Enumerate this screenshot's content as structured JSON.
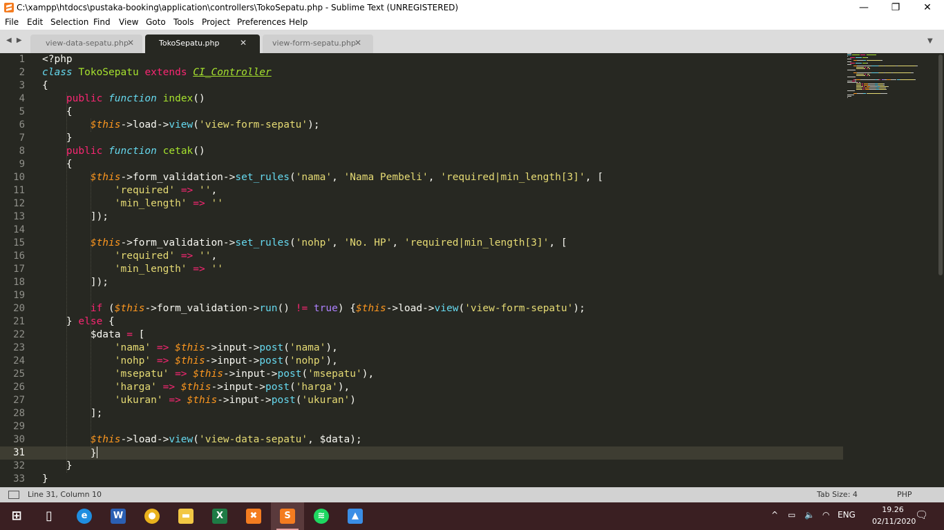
{
  "window": {
    "title": "C:\\xampp\\htdocs\\pustaka-booking\\application\\controllers\\TokoSepatu.php - Sublime Text (UNREGISTERED)",
    "minimize": "—",
    "maximize": "❐",
    "close": "✕"
  },
  "menu": [
    "File",
    "Edit",
    "Selection",
    "Find",
    "View",
    "Goto",
    "Tools",
    "Project",
    "Preferences",
    "Help"
  ],
  "tabs": [
    {
      "label": "view-data-sepatu.php",
      "close": "✕",
      "active": false
    },
    {
      "label": "TokoSepatu.php",
      "close": "✕",
      "active": true
    },
    {
      "label": "view-form-sepatu.php",
      "close": "✕",
      "active": false
    }
  ],
  "tabbar": {
    "nav": "◀ ▶",
    "dropdown": "▼"
  },
  "editor": {
    "line_numbers": [
      "1",
      "2",
      "3",
      "4",
      "5",
      "6",
      "7",
      "8",
      "9",
      "10",
      "11",
      "12",
      "13",
      "14",
      "15",
      "16",
      "17",
      "18",
      "19",
      "20",
      "21",
      "22",
      "23",
      "24",
      "25",
      "26",
      "27",
      "28",
      "29",
      "30",
      "31",
      "32",
      "33"
    ],
    "active_line": 31,
    "lines": [
      [
        [
          "<?php",
          "pl"
        ]
      ],
      [
        [
          "class",
          "st"
        ],
        [
          " ",
          "pl"
        ],
        [
          "TokoSepatu",
          "ent"
        ],
        [
          " ",
          "pl"
        ],
        [
          "extends",
          "kw"
        ],
        [
          " ",
          "pl"
        ],
        [
          "CI_Controller",
          "inh"
        ]
      ],
      [
        [
          "{",
          "pl"
        ]
      ],
      [
        [
          "    ",
          "pl"
        ],
        [
          "public",
          "kw"
        ],
        [
          " ",
          "pl"
        ],
        [
          "function",
          "st"
        ],
        [
          " ",
          "pl"
        ],
        [
          "index",
          "ent"
        ],
        [
          "()",
          "pl"
        ]
      ],
      [
        [
          "    {",
          "pl"
        ]
      ],
      [
        [
          "        ",
          "pl"
        ],
        [
          "$this",
          "var"
        ],
        [
          "->load->",
          "pl"
        ],
        [
          "view",
          "fn"
        ],
        [
          "(",
          "pl"
        ],
        [
          "'view-form-sepatu'",
          "str"
        ],
        [
          ");",
          "pl"
        ]
      ],
      [
        [
          "    }",
          "pl"
        ]
      ],
      [
        [
          "    ",
          "pl"
        ],
        [
          "public",
          "kw"
        ],
        [
          " ",
          "pl"
        ],
        [
          "function",
          "st"
        ],
        [
          " ",
          "pl"
        ],
        [
          "cetak",
          "ent"
        ],
        [
          "()",
          "pl"
        ]
      ],
      [
        [
          "    {",
          "pl"
        ]
      ],
      [
        [
          "        ",
          "pl"
        ],
        [
          "$this",
          "var"
        ],
        [
          "->form_validation->",
          "pl"
        ],
        [
          "set_rules",
          "fn"
        ],
        [
          "(",
          "pl"
        ],
        [
          "'nama'",
          "str"
        ],
        [
          ", ",
          "pl"
        ],
        [
          "'Nama Pembeli'",
          "str"
        ],
        [
          ", ",
          "pl"
        ],
        [
          "'required|min_length[3]'",
          "str"
        ],
        [
          ", [",
          "pl"
        ]
      ],
      [
        [
          "            ",
          "pl"
        ],
        [
          "'required'",
          "str"
        ],
        [
          " ",
          "pl"
        ],
        [
          "=>",
          "kw"
        ],
        [
          " ",
          "pl"
        ],
        [
          "''",
          "str"
        ],
        [
          ",",
          "pl"
        ]
      ],
      [
        [
          "            ",
          "pl"
        ],
        [
          "'min_length'",
          "str"
        ],
        [
          " ",
          "pl"
        ],
        [
          "=>",
          "kw"
        ],
        [
          " ",
          "pl"
        ],
        [
          "''",
          "str"
        ]
      ],
      [
        [
          "        ]);",
          "pl"
        ]
      ],
      [
        [
          "",
          "pl"
        ]
      ],
      [
        [
          "        ",
          "pl"
        ],
        [
          "$this",
          "var"
        ],
        [
          "->form_validation->",
          "pl"
        ],
        [
          "set_rules",
          "fn"
        ],
        [
          "(",
          "pl"
        ],
        [
          "'nohp'",
          "str"
        ],
        [
          ", ",
          "pl"
        ],
        [
          "'No. HP'",
          "str"
        ],
        [
          ", ",
          "pl"
        ],
        [
          "'required|min_length[3]'",
          "str"
        ],
        [
          ", [",
          "pl"
        ]
      ],
      [
        [
          "            ",
          "pl"
        ],
        [
          "'required'",
          "str"
        ],
        [
          " ",
          "pl"
        ],
        [
          "=>",
          "kw"
        ],
        [
          " ",
          "pl"
        ],
        [
          "''",
          "str"
        ],
        [
          ",",
          "pl"
        ]
      ],
      [
        [
          "            ",
          "pl"
        ],
        [
          "'min_length'",
          "str"
        ],
        [
          " ",
          "pl"
        ],
        [
          "=>",
          "kw"
        ],
        [
          " ",
          "pl"
        ],
        [
          "''",
          "str"
        ]
      ],
      [
        [
          "        ]);",
          "pl"
        ]
      ],
      [
        [
          "",
          "pl"
        ]
      ],
      [
        [
          "        ",
          "pl"
        ],
        [
          "if",
          "kw"
        ],
        [
          " (",
          "pl"
        ],
        [
          "$this",
          "var"
        ],
        [
          "->form_validation->",
          "pl"
        ],
        [
          "run",
          "fn"
        ],
        [
          "() ",
          "pl"
        ],
        [
          "!=",
          "kw"
        ],
        [
          " ",
          "pl"
        ],
        [
          "true",
          "con"
        ],
        [
          ") {",
          "pl"
        ],
        [
          "$this",
          "var"
        ],
        [
          "->load->",
          "pl"
        ],
        [
          "view",
          "fn"
        ],
        [
          "(",
          "pl"
        ],
        [
          "'view-form-sepatu'",
          "str"
        ],
        [
          ");",
          "pl"
        ]
      ],
      [
        [
          "    } ",
          "pl"
        ],
        [
          "else",
          "kw"
        ],
        [
          " {",
          "pl"
        ]
      ],
      [
        [
          "        $data ",
          "pl"
        ],
        [
          "=",
          "kw"
        ],
        [
          " [",
          "pl"
        ]
      ],
      [
        [
          "            ",
          "pl"
        ],
        [
          "'nama'",
          "str"
        ],
        [
          " ",
          "pl"
        ],
        [
          "=>",
          "kw"
        ],
        [
          " ",
          "pl"
        ],
        [
          "$this",
          "var"
        ],
        [
          "->input->",
          "pl"
        ],
        [
          "post",
          "fn"
        ],
        [
          "(",
          "pl"
        ],
        [
          "'nama'",
          "str"
        ],
        [
          "),",
          "pl"
        ]
      ],
      [
        [
          "            ",
          "pl"
        ],
        [
          "'nohp'",
          "str"
        ],
        [
          " ",
          "pl"
        ],
        [
          "=>",
          "kw"
        ],
        [
          " ",
          "pl"
        ],
        [
          "$this",
          "var"
        ],
        [
          "->input->",
          "pl"
        ],
        [
          "post",
          "fn"
        ],
        [
          "(",
          "pl"
        ],
        [
          "'nohp'",
          "str"
        ],
        [
          "),",
          "pl"
        ]
      ],
      [
        [
          "            ",
          "pl"
        ],
        [
          "'msepatu'",
          "str"
        ],
        [
          " ",
          "pl"
        ],
        [
          "=>",
          "kw"
        ],
        [
          " ",
          "pl"
        ],
        [
          "$this",
          "var"
        ],
        [
          "->input->",
          "pl"
        ],
        [
          "post",
          "fn"
        ],
        [
          "(",
          "pl"
        ],
        [
          "'msepatu'",
          "str"
        ],
        [
          "),",
          "pl"
        ]
      ],
      [
        [
          "            ",
          "pl"
        ],
        [
          "'harga'",
          "str"
        ],
        [
          " ",
          "pl"
        ],
        [
          "=>",
          "kw"
        ],
        [
          " ",
          "pl"
        ],
        [
          "$this",
          "var"
        ],
        [
          "->input->",
          "pl"
        ],
        [
          "post",
          "fn"
        ],
        [
          "(",
          "pl"
        ],
        [
          "'harga'",
          "str"
        ],
        [
          "),",
          "pl"
        ]
      ],
      [
        [
          "            ",
          "pl"
        ],
        [
          "'ukuran'",
          "str"
        ],
        [
          " ",
          "pl"
        ],
        [
          "=>",
          "kw"
        ],
        [
          " ",
          "pl"
        ],
        [
          "$this",
          "var"
        ],
        [
          "->input->",
          "pl"
        ],
        [
          "post",
          "fn"
        ],
        [
          "(",
          "pl"
        ],
        [
          "'ukuran'",
          "str"
        ],
        [
          ")",
          "pl"
        ]
      ],
      [
        [
          "        ];",
          "pl"
        ]
      ],
      [
        [
          "",
          "pl"
        ]
      ],
      [
        [
          "        ",
          "pl"
        ],
        [
          "$this",
          "var"
        ],
        [
          "->load->",
          "pl"
        ],
        [
          "view",
          "fn"
        ],
        [
          "(",
          "pl"
        ],
        [
          "'view-data-sepatu'",
          "str"
        ],
        [
          ", $data);",
          "pl"
        ]
      ],
      [
        [
          "        }",
          "pl"
        ]
      ],
      [
        [
          "    }",
          "pl"
        ]
      ],
      [
        [
          "}",
          "pl"
        ]
      ]
    ]
  },
  "statusbar": {
    "position": "Line 31, Column 10",
    "tab_size": "Tab Size: 4",
    "syntax": "PHP"
  },
  "taskbar": {
    "apps": [
      {
        "name": "start-icon",
        "glyph": "⊞",
        "color": "#ffffff"
      },
      {
        "name": "task-view-icon",
        "glyph": "▯",
        "color": "#ffffff"
      },
      {
        "name": "edge-icon",
        "glyph": "e",
        "color": "#1f8ee0"
      },
      {
        "name": "word-icon",
        "glyph": "W",
        "color": "#2b5fb3"
      },
      {
        "name": "chrome-icon",
        "glyph": "●",
        "color": "#e9b21c"
      },
      {
        "name": "file-explorer-icon",
        "glyph": "▬",
        "color": "#f2c744"
      },
      {
        "name": "excel-icon",
        "glyph": "X",
        "color": "#1e7b45"
      },
      {
        "name": "xampp-icon",
        "glyph": "✖",
        "color": "#f47c20"
      },
      {
        "name": "sublime-text-icon",
        "glyph": "S",
        "color": "#f47c20"
      },
      {
        "name": "spotify-icon",
        "glyph": "≋",
        "color": "#1ed760"
      },
      {
        "name": "photos-icon",
        "glyph": "▲",
        "color": "#3a8ee6"
      }
    ],
    "tray": {
      "chevron": "^",
      "battery": "▭",
      "volume": "🔈",
      "wifi": "◠",
      "language": "ENG",
      "notification": "🗨"
    },
    "time": "19.26",
    "date": "02/11/2020"
  },
  "colors": {
    "editor_bg": "#272822",
    "keyword": "#f92672",
    "string": "#e6db74",
    "function": "#66d9ef",
    "entity": "#a6e22e",
    "variable": "#fd971f",
    "constant": "#ae81ff"
  }
}
